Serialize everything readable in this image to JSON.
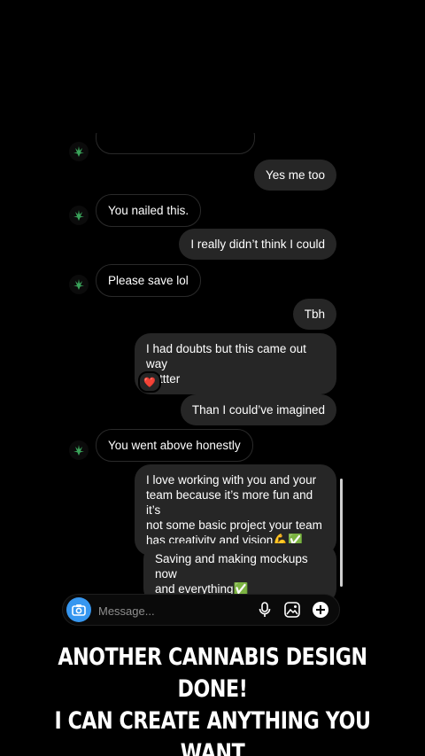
{
  "chat": {
    "messages": [
      {
        "side": "out",
        "text": "Yes me too"
      },
      {
        "side": "in",
        "text": "You nailed this."
      },
      {
        "side": "out",
        "text": "I really didn’t think I could"
      },
      {
        "side": "in",
        "text": "Please save lol"
      },
      {
        "side": "out",
        "text": "Tbh"
      },
      {
        "side": "out",
        "line1": "I had doubts but this came out way",
        "line2": "bettter",
        "reaction": "❤️"
      },
      {
        "side": "out",
        "text": "Than I could’ve imagined"
      },
      {
        "side": "in",
        "text": "You went above honestly"
      },
      {
        "side": "out",
        "line1": "I love working with you and your",
        "line2": "team because it’s more fun and it’s",
        "line3": "not some basic project your team",
        "line4": "has creativity and vision💪✅"
      },
      {
        "side": "out",
        "line1": "Saving and making mockups now",
        "line2": "and everything✅"
      }
    ]
  },
  "composer": {
    "placeholder": "Message..."
  },
  "caption": {
    "line1": "ANOTHER CANNABIS DESIGN DONE!",
    "line2": "I CAN CREATE ANYTHING YOU WANT"
  },
  "colors": {
    "background": "#000000",
    "outgoing_bubble": "#262626",
    "incoming_border": "#2a2a2a",
    "camera_button": "#3797f0",
    "avatar_leaf": "#3aa35a"
  },
  "icons": [
    "camera-icon",
    "microphone-icon",
    "gallery-icon",
    "plus-icon",
    "cannabis-leaf-avatar-icon",
    "heart-reaction-icon"
  ]
}
